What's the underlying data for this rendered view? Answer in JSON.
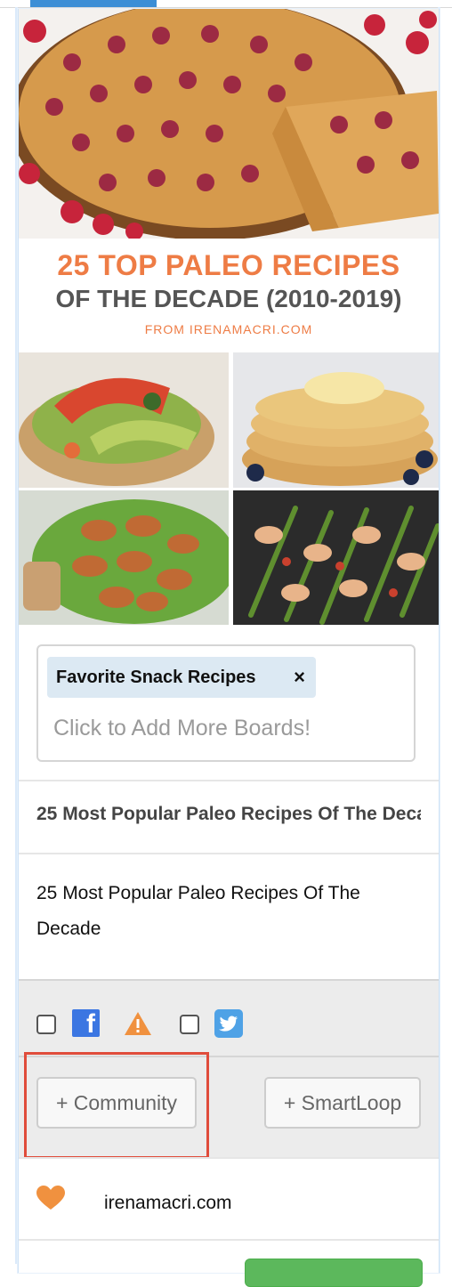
{
  "pin": {
    "overlay_line1": "25 TOP PALEO RECIPES",
    "overlay_line2": "OF THE DECADE (2010-2019)",
    "overlay_line3": "FROM IRENAMACRI.COM"
  },
  "boards": {
    "selected": [
      "Favorite Snack Recipes"
    ],
    "remove_symbol": "×",
    "placeholder": "Click to Add More Boards!"
  },
  "post": {
    "title": "25 Most Popular Paleo Recipes Of The Decade",
    "description": "25 Most Popular Paleo Recipes Of The Decade"
  },
  "social": {
    "networks": [
      {
        "icon": "facebook-icon",
        "checked": false
      },
      {
        "icon": "twitter-icon",
        "checked": false
      }
    ],
    "warning_icon": "warning-icon"
  },
  "actions": {
    "community_label": "+ Community",
    "smartloop_label": "+ SmartLoop"
  },
  "source": {
    "domain": "irenamacri.com",
    "icon": "heart-icon"
  },
  "colors": {
    "accent_blue": "#3b8ed6",
    "highlight_red": "#e04c3b",
    "overlay_orange": "#ee7c45",
    "facebook_blue": "#3b76e2",
    "twitter_blue": "#4fa2e6",
    "heart_orange": "#f0913f",
    "green_button": "#5cb85c"
  }
}
